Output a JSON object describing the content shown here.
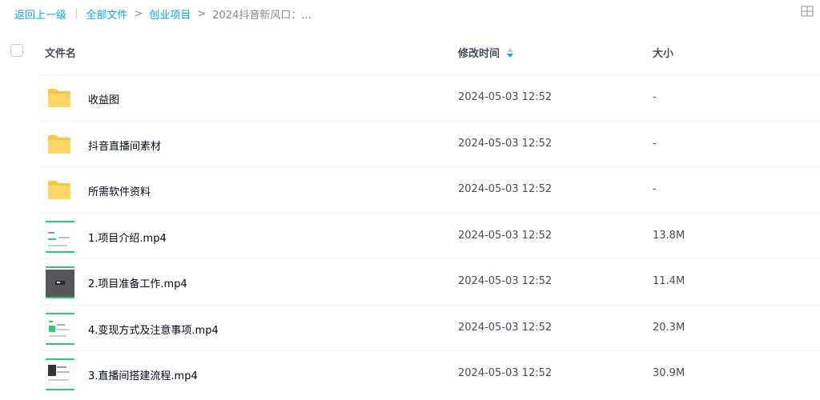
{
  "breadcrumb": {
    "back": "返回上一级",
    "all_files": "全部文件",
    "parent": "创业项目",
    "current": "2024抖音新风口：..."
  },
  "header": {
    "name": "文件名",
    "time": "修改时间",
    "size": "大小"
  },
  "colors": {
    "accent": "#06a7ff",
    "folder": "#ffc53d",
    "thumb_green": "#2ecc71"
  },
  "files": [
    {
      "name": "收益图",
      "time": "2024-05-03 12:52",
      "size": "-",
      "icon": "folder-icon"
    },
    {
      "name": "抖音直播间素材",
      "time": "2024-05-03 12:52",
      "size": "-",
      "icon": "folder-icon"
    },
    {
      "name": "所需软件资料",
      "time": "2024-05-03 12:52",
      "size": "-",
      "icon": "folder-icon"
    },
    {
      "name": "1.项目介绍.mp4",
      "time": "2024-05-03 12:52",
      "size": "13.8M",
      "icon": "video-thumbnail"
    },
    {
      "name": "2.项目准备工作.mp4",
      "time": "2024-05-03 12:52",
      "size": "11.4M",
      "icon": "video-thumbnail"
    },
    {
      "name": "4.变现方式及注意事项.mp4",
      "time": "2024-05-03 12:52",
      "size": "20.3M",
      "icon": "video-thumbnail"
    },
    {
      "name": "3.直播间搭建流程.mp4",
      "time": "2024-05-03 12:52",
      "size": "30.9M",
      "icon": "video-thumbnail"
    }
  ]
}
